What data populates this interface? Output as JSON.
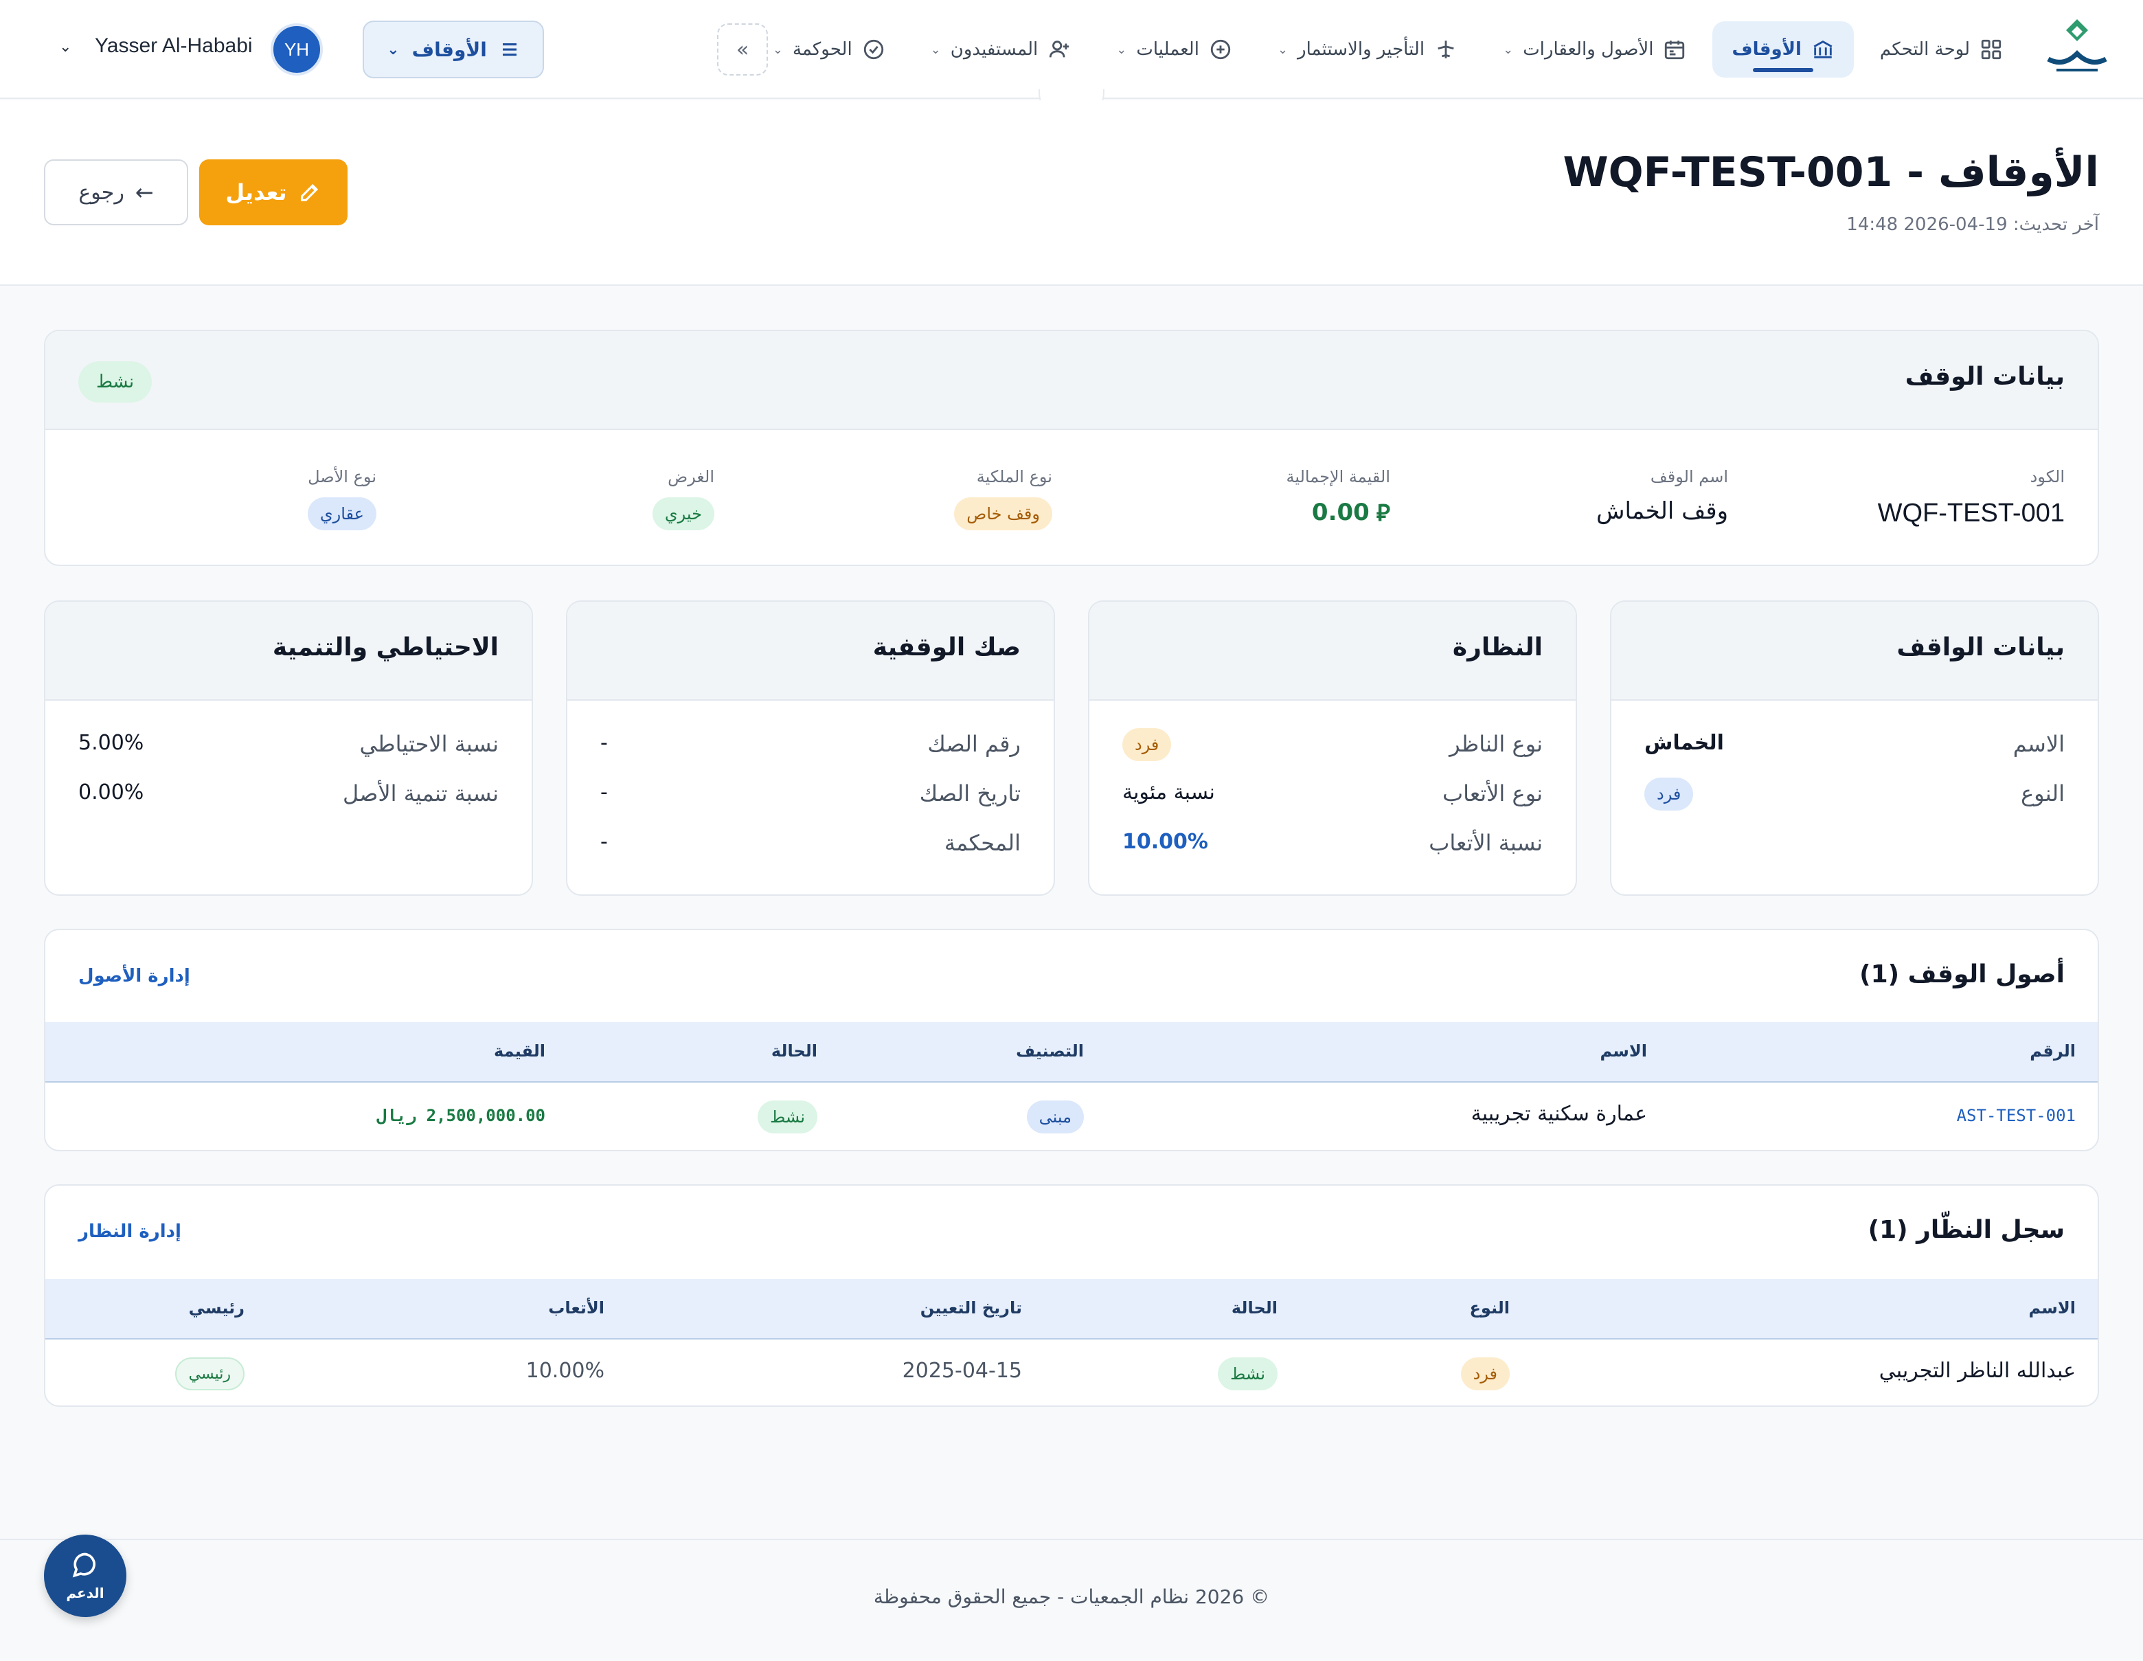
{
  "nav": {
    "items": [
      {
        "label": "لوحة التحكم",
        "icon": "grid-icon"
      },
      {
        "label": "الأوقاف",
        "icon": "bank-icon",
        "active": true
      },
      {
        "label": "الأصول والعقارات",
        "icon": "calendar-icon"
      },
      {
        "label": "التأجير والاستثمار",
        "icon": "plane-icon"
      },
      {
        "label": "العمليات",
        "icon": "plus-circle-icon"
      },
      {
        "label": "المستفيدون",
        "icon": "user-plus-icon"
      },
      {
        "label": "الحوكمة",
        "icon": "check-circle-icon"
      }
    ],
    "module_select": "الأوقاف",
    "user_initials": "YH",
    "user_name": "Yasser Al-Hababi"
  },
  "header": {
    "title": "الأوقاف - WQF-TEST-001",
    "updated": "آخر تحديث: 19-04-2026 14:48",
    "edit_label": "تعديل",
    "back_label": "رجوع"
  },
  "waqf_info": {
    "title": "بيانات الوقف",
    "status": "نشط",
    "fields": {
      "code_label": "الكود",
      "code": "WQF-TEST-001",
      "name_label": "اسم الوقف",
      "name": "وقف الخماش",
      "value_label": "القيمة الإجمالية",
      "value": "0.00",
      "ownership_label": "نوع الملكية",
      "ownership": "وقف خاص",
      "purpose_label": "الغرض",
      "purpose": "خيري",
      "asset_type_label": "نوع الأصل",
      "asset_type": "عقاري"
    }
  },
  "founder": {
    "title": "بيانات الواقف",
    "name_label": "الاسم",
    "name": "الخماش",
    "type_label": "النوع",
    "type": "فرد"
  },
  "supervision": {
    "title": "النظارة",
    "type_label": "نوع الناظر",
    "type": "فرد",
    "fees_type_label": "نوع الأتعاب",
    "fees_type": "نسبة مئوية",
    "fees_rate_label": "نسبة الأتعاب",
    "fees_rate": "10.00%"
  },
  "deed": {
    "title": "صك الوقفية",
    "number_label": "رقم الصك",
    "number": "-",
    "date_label": "تاريخ الصك",
    "date": "-",
    "court_label": "المحكمة",
    "court": "-"
  },
  "reserve": {
    "title": "الاحتياطي والتنمية",
    "reserve_label": "نسبة الاحتياطي",
    "reserve": "5.00%",
    "growth_label": "نسبة تنمية الأصل",
    "growth": "0.00%"
  },
  "assets": {
    "title": "أصول الوقف (1)",
    "manage_link": "إدارة الأصول",
    "columns": [
      "الرقم",
      "الاسم",
      "التصنيف",
      "الحالة",
      "القيمة"
    ],
    "rows": [
      {
        "code": "AST-TEST-001",
        "name": "عمارة سكنية تجريبية",
        "category": "مبنى",
        "status": "نشط",
        "value": "2,500,000.00 ريال"
      }
    ]
  },
  "supervisors": {
    "title": "سجل النظّار (1)",
    "manage_link": "إدارة النظار",
    "columns": [
      "الاسم",
      "النوع",
      "الحالة",
      "تاريخ التعيين",
      "الأتعاب",
      "رئيسي"
    ],
    "rows": [
      {
        "name": "عبدالله الناظر التجريبي",
        "type": "فرد",
        "status": "نشط",
        "date": "2025-04-15",
        "fees": "10.00%",
        "primary": "رئيسي"
      }
    ]
  },
  "footer": {
    "text": "© 2026 نظام الجمعيات - جميع الحقوق محفوظة"
  },
  "support": {
    "label": "الدعم"
  },
  "colors": {
    "primary": "#1d4f9e",
    "accent": "#f5a00d",
    "success": "#1a7a43"
  }
}
